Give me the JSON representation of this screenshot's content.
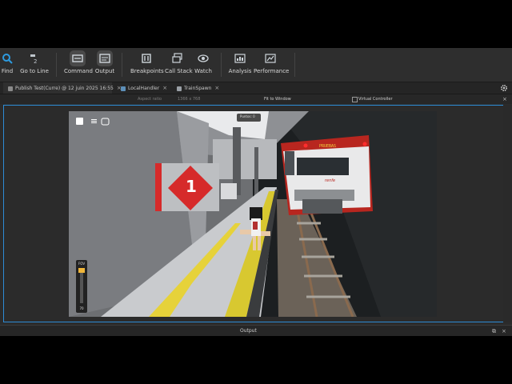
{
  "toolbar": {
    "items": [
      {
        "label": "Find",
        "icon": "magnifier-icon"
      },
      {
        "label": "Go to Line",
        "icon": "goto-line-icon"
      },
      {
        "label": "Command",
        "icon": "command-bar-icon"
      },
      {
        "label": "Output",
        "icon": "output-window-icon"
      },
      {
        "label": "Breakpoints",
        "icon": "breakpoints-icon"
      },
      {
        "label": "Call Stack",
        "icon": "call-stack-icon"
      },
      {
        "label": "Watch",
        "icon": "eye-icon"
      },
      {
        "label": "Analysis",
        "icon": "analysis-icon"
      },
      {
        "label": "Performance",
        "icon": "performance-icon"
      }
    ]
  },
  "tabs": [
    {
      "label": "Publish Test(Curre) @ 12 juin 2025 16:55"
    },
    {
      "label": "LocalHandler"
    },
    {
      "label": "TrainSpawn"
    }
  ],
  "viewport_toolbar": {
    "left_text": "Aspect ratio",
    "resolution": "1366 x 768",
    "fit": "Fit to Window",
    "virtual_controller": "Virtual Controller"
  },
  "game": {
    "platform_number": "1",
    "train_destination": "PRUEBAS",
    "train_brand": "renfe",
    "points_label": "Puntos:",
    "points_value": "0",
    "fov_label": "FOV",
    "fov_value": "70",
    "colors": {
      "sign_red": "#d62a2a",
      "train_red": "#b8261f",
      "platform_yellow": "#e6d23a"
    }
  },
  "output_panel": {
    "title": "Output"
  }
}
